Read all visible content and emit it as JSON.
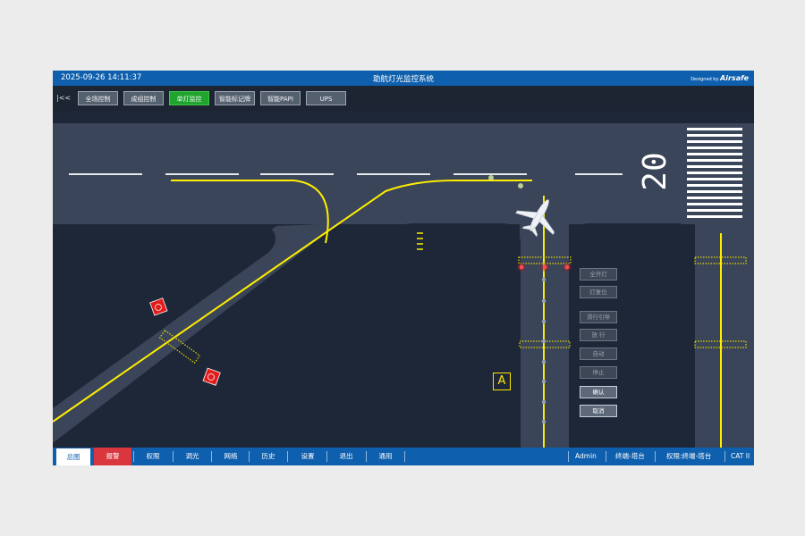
{
  "titlebar": {
    "datetime": "2025-09-26 14:11:37",
    "title": "助航灯光监控系统",
    "designed_by": "Designed by",
    "brand": "Airsafe"
  },
  "toolbar": {
    "collapse": "|<<",
    "buttons": [
      "全场控制",
      "成组控制",
      "单灯监控",
      "智能标记牌",
      "智能PAPI",
      "UPS"
    ],
    "active": "单灯监控"
  },
  "map": {
    "runway_number": "20",
    "marker_label": "A"
  },
  "side_panel": {
    "buttons": [
      "全开灯",
      "灯复位",
      "滑行引导",
      "放 行",
      "自动",
      "停止",
      "确认",
      "取消"
    ],
    "enabled": [
      "确认",
      "取消"
    ]
  },
  "statusbar": {
    "tabs": [
      "总图",
      "报警",
      "权限",
      "调光",
      "网络",
      "历史",
      "设置",
      "退出",
      "通用"
    ],
    "user": "Admin",
    "terminal": "终端-塔台",
    "permission": "权限:终端-塔台",
    "category": "CAT II"
  },
  "colors": {
    "titlebar": "#0e5fad",
    "active_button": "#1fa52d",
    "taxi_line": "#ffee00",
    "stop_bar": "#e8d400",
    "alarm": "#d9363e",
    "ground": "#1e2737",
    "pavement": "#3a4559"
  }
}
